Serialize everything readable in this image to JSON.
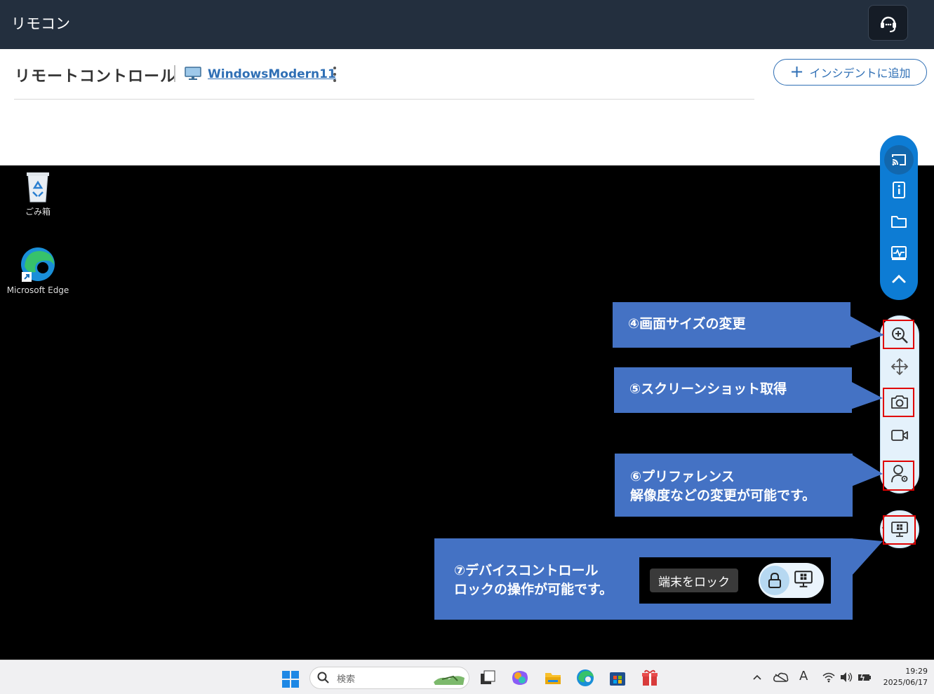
{
  "appbar": {
    "title": "リモコン",
    "support_icon": "headset-icon"
  },
  "header": {
    "title": "リモートコントロール",
    "device_name": "WindowsModern11",
    "add_incident_label": "インシデントに追加"
  },
  "desktop": {
    "icons": [
      {
        "label": "ごみ箱",
        "icon": "recycle-bin-icon"
      },
      {
        "label": "Microsoft Edge",
        "icon": "edge-icon"
      }
    ]
  },
  "taskbar": {
    "search_placeholder": "検索",
    "time": "19:29",
    "date": "2025/06/17",
    "ime_label": "A"
  },
  "toolbar": {
    "top_group": [
      "cast-icon",
      "info-icon",
      "folder-icon",
      "monitor-activity-icon",
      "chevron-up-icon"
    ],
    "mid_group": [
      "zoom-in-icon",
      "move-icon",
      "camera-icon",
      "video-icon",
      "user-settings-icon"
    ],
    "bottom_group": [
      "windows-monitor-icon"
    ]
  },
  "callouts": {
    "c4": {
      "line1": "④画面サイズの変更"
    },
    "c5": {
      "line1": "⑤スクリーンショット取得"
    },
    "c6": {
      "line1": "⑥プリファレンス",
      "line2": "解像度などの変更が可能です。"
    },
    "c7": {
      "line1": "⑦デバイスコントロール",
      "line2": "ロックの操作が可能です。",
      "lock_label": "端末をロック"
    }
  },
  "colors": {
    "appbar": "#232f3e",
    "accent": "#0d7cd4",
    "callout": "#4472c4",
    "highlight": "#e00000",
    "link": "#2f6fb5"
  }
}
